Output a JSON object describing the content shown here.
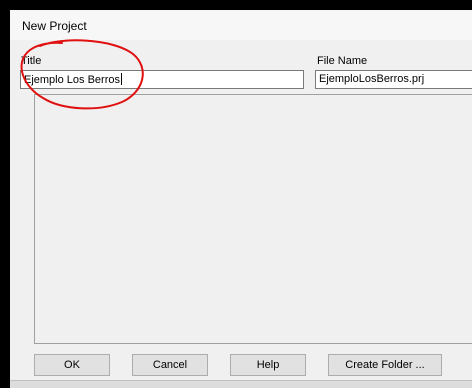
{
  "dialog": {
    "title": "New Project"
  },
  "fields": {
    "title_label": "Title",
    "title_value": "Ejemplo Los Berros",
    "file_name_label": "File Name",
    "file_name_value": "EjemploLosBerros.prj"
  },
  "buttons": {
    "ok": "OK",
    "cancel": "Cancel",
    "help": "Help",
    "create_folder": "Create Folder ..."
  },
  "annotation": {
    "color": "#e01010"
  }
}
